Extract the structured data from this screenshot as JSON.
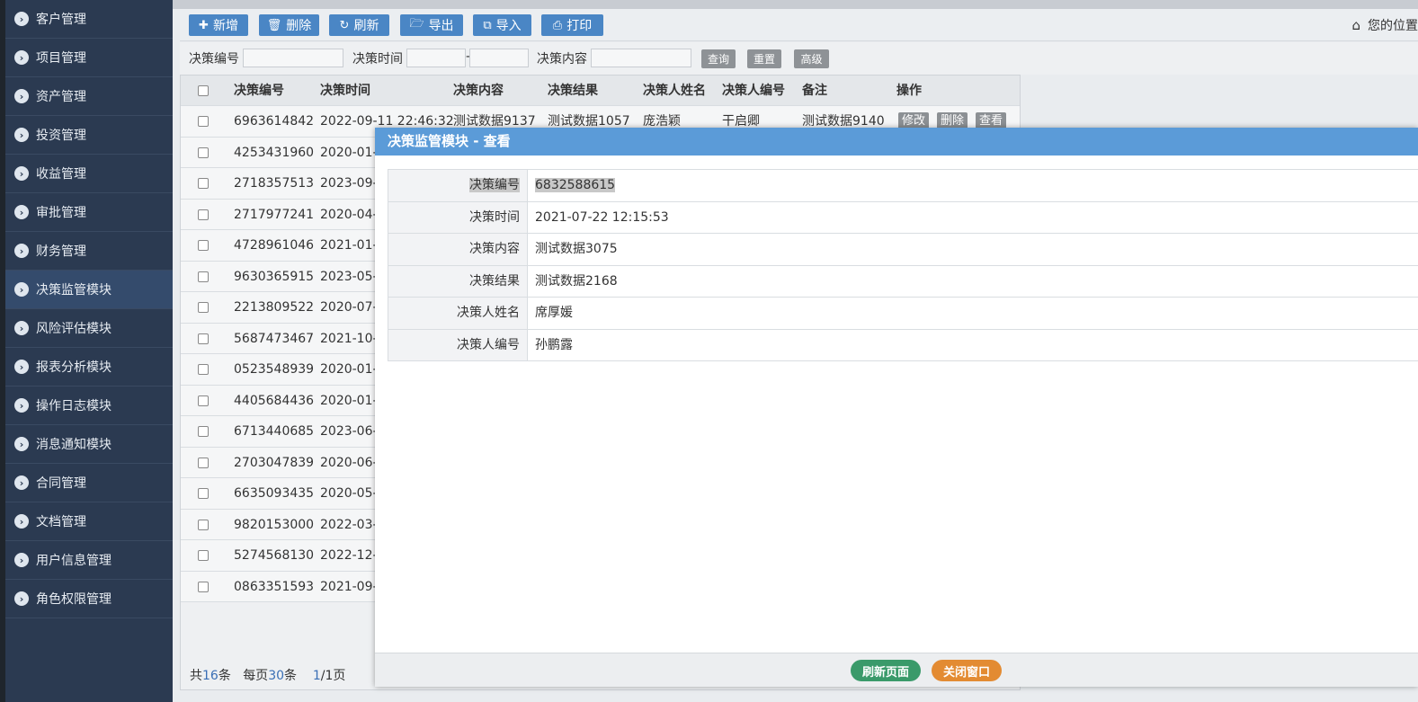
{
  "sidebar": {
    "items": [
      {
        "label": "客户管理",
        "active": false
      },
      {
        "label": "项目管理",
        "active": false
      },
      {
        "label": "资产管理",
        "active": false
      },
      {
        "label": "投资管理",
        "active": false
      },
      {
        "label": "收益管理",
        "active": false
      },
      {
        "label": "审批管理",
        "active": false
      },
      {
        "label": "财务管理",
        "active": false
      },
      {
        "label": "决策监管模块",
        "active": true
      },
      {
        "label": "风险评估模块",
        "active": false
      },
      {
        "label": "报表分析模块",
        "active": false
      },
      {
        "label": "操作日志模块",
        "active": false
      },
      {
        "label": "消息通知模块",
        "active": false
      },
      {
        "label": "合同管理",
        "active": false
      },
      {
        "label": "文档管理",
        "active": false
      },
      {
        "label": "用户信息管理",
        "active": false
      },
      {
        "label": "角色权限管理",
        "active": false
      }
    ]
  },
  "toolbar": {
    "add": "新增",
    "delete": "删除",
    "refresh": "刷新",
    "export": "导出",
    "import": "导入",
    "print": "打印",
    "location": "您的位置"
  },
  "search": {
    "code_label": "决策编号",
    "time_label": "决策时间",
    "time_sep": "-",
    "content_label": "决策内容",
    "query": "查询",
    "reset": "重置",
    "advanced": "高级"
  },
  "table": {
    "headers": [
      "决策编号",
      "决策时间",
      "决策内容",
      "决策结果",
      "决策人姓名",
      "决策人编号",
      "备注",
      "操作"
    ],
    "rows": [
      [
        "6963614842",
        "2022-09-11 22:46:32",
        "测试数据9137",
        "测试数据1057",
        "庞浩颖",
        "干启卿",
        "测试数据9140"
      ],
      [
        "4253431960",
        "2020-01-0",
        "",
        "",
        "",
        "",
        ""
      ],
      [
        "2718357513",
        "2023-09-1",
        "",
        "",
        "",
        "",
        ""
      ],
      [
        "2717977241",
        "2020-04-1",
        "",
        "",
        "",
        "",
        ""
      ],
      [
        "4728961046",
        "2021-01-2",
        "",
        "",
        "",
        "",
        ""
      ],
      [
        "9630365915",
        "2023-05-0",
        "",
        "",
        "",
        "",
        ""
      ],
      [
        "2213809522",
        "2020-07-0",
        "",
        "",
        "",
        "",
        ""
      ],
      [
        "5687473467",
        "2021-10-2",
        "",
        "",
        "",
        "",
        ""
      ],
      [
        "0523548939",
        "2020-01-3",
        "",
        "",
        "",
        "",
        ""
      ],
      [
        "4405684436",
        "2020-01-1",
        "",
        "",
        "",
        "",
        ""
      ],
      [
        "6713440685",
        "2023-06-3",
        "",
        "",
        "",
        "",
        ""
      ],
      [
        "2703047839",
        "2020-06-0",
        "",
        "",
        "",
        "",
        ""
      ],
      [
        "6635093435",
        "2020-05-0",
        "",
        "",
        "",
        "",
        ""
      ],
      [
        "9820153000",
        "2022-03-2",
        "",
        "",
        "",
        "",
        ""
      ],
      [
        "5274568130",
        "2022-12-1",
        "",
        "",
        "",
        "",
        ""
      ],
      [
        "0863351593",
        "2021-09-2",
        "",
        "",
        "",
        "",
        ""
      ]
    ],
    "ops": {
      "edit": "修改",
      "delete": "删除",
      "view": "查看"
    }
  },
  "pager": {
    "total_prefix": "共",
    "total": "16",
    "total_suffix": "条",
    "per_prefix": "每页",
    "per": "30",
    "per_suffix": "条",
    "page_current": "1",
    "page_sep": "/",
    "page_total": "1页"
  },
  "modal": {
    "title": "决策监管模块 - 查看",
    "fields": [
      {
        "label": "决策编号",
        "value": "6832588615"
      },
      {
        "label": "决策时间",
        "value": "2021-07-22 12:15:53"
      },
      {
        "label": "决策内容",
        "value": "测试数据3075"
      },
      {
        "label": "决策结果",
        "value": "测试数据2168"
      },
      {
        "label": "决策人姓名",
        "value": "席厚媛"
      },
      {
        "label": "决策人编号",
        "value": "孙鹏露"
      }
    ],
    "refresh_btn": "刷新页面",
    "close_btn": "关闭窗口"
  },
  "colors": {
    "sidebar_bg": "#2b3a51",
    "primary_btn": "#4a86c5",
    "modal_header": "#5b9bd8",
    "refresh_green": "#3a9a6a",
    "close_orange": "#e38b32"
  }
}
